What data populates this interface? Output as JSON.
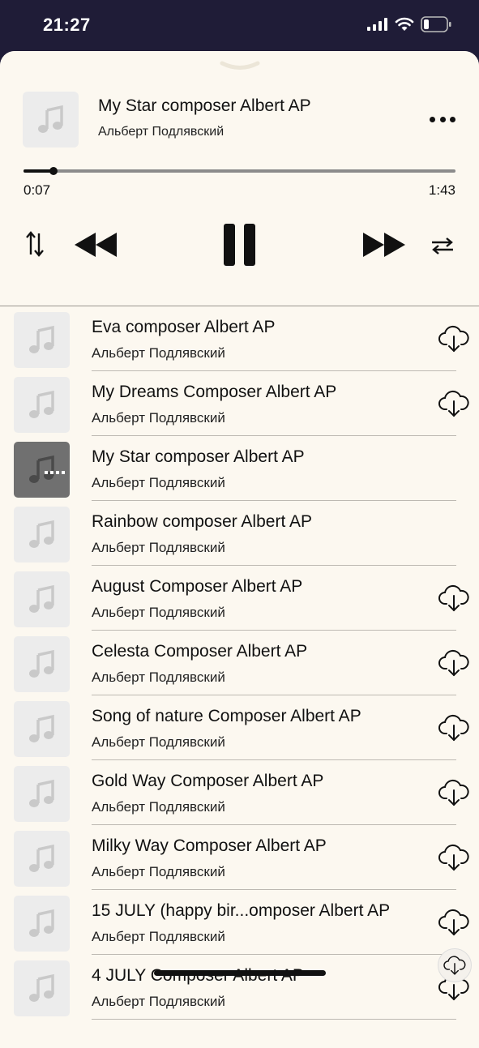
{
  "status_bar": {
    "time": "21:27",
    "icons": [
      "signal-icon",
      "wifi-icon",
      "battery-icon"
    ]
  },
  "player": {
    "title": "My Star composer Albert AP",
    "artist": "Альберт Подлявский",
    "elapsed": "0:07",
    "total": "1:43",
    "progress": 0.07,
    "icons": [
      "more-icon",
      "sort-icon",
      "rewind-icon",
      "pause-icon",
      "forward-icon",
      "repeat-icon"
    ]
  },
  "tracks": [
    {
      "title": "",
      "artist": "Альберт Подлявский",
      "downloadable": true,
      "active": false
    },
    {
      "title": "Eva composer Albert AP",
      "artist": "Альберт Подлявский",
      "downloadable": true,
      "active": false
    },
    {
      "title": "My Dreams Composer Albert AP",
      "artist": "Альберт Подлявский",
      "downloadable": true,
      "active": false
    },
    {
      "title": "My Star composer Albert AP",
      "artist": "Альберт Подлявский",
      "downloadable": false,
      "active": true
    },
    {
      "title": "Rainbow composer Albert AP",
      "artist": "Альберт Подлявский",
      "downloadable": false,
      "active": false
    },
    {
      "title": "August Composer Albert AP",
      "artist": "Альберт Подлявский",
      "downloadable": true,
      "active": false
    },
    {
      "title": "Celesta Composer Albert AP",
      "artist": "Альберт Подлявский",
      "downloadable": true,
      "active": false
    },
    {
      "title": "Song of nature Composer Albert AP",
      "artist": "Альберт Подлявский",
      "downloadable": true,
      "active": false
    },
    {
      "title": "Gold Way Composer Albert AP",
      "artist": "Альберт Подлявский",
      "downloadable": true,
      "active": false
    },
    {
      "title": "Milky Way Composer Albert AP",
      "artist": "Альберт Подлявский",
      "downloadable": true,
      "active": false
    },
    {
      "title": "15 JULY (happy bir...omposer Albert AP",
      "artist": "Альберт Подлявский",
      "downloadable": true,
      "active": false
    },
    {
      "title": "4 JULY Composer Albert AP",
      "artist": "Альберт Подлявский",
      "downloadable": true,
      "active": false
    }
  ],
  "colors": {
    "status_bg": "#1f1c37",
    "sheet_bg": "#fcf8f0",
    "thumb_bg": "#ececec",
    "active_thumb_bg": "#707070"
  }
}
